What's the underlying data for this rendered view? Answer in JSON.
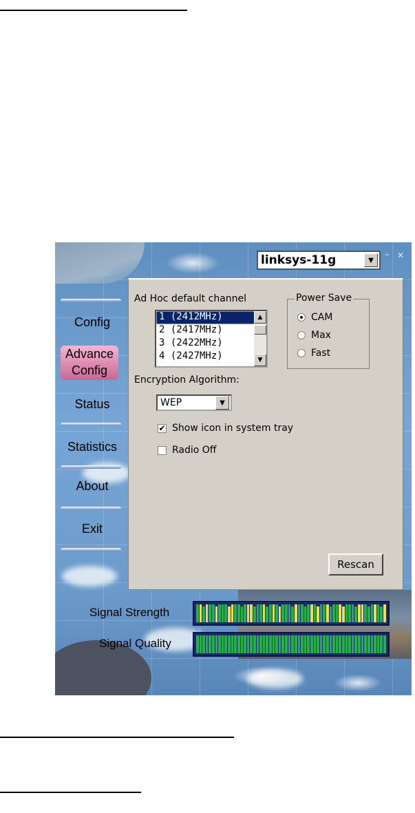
{
  "window": {
    "ssid": "linksys-11g",
    "minimize_glyph": "–",
    "close_glyph": "✕"
  },
  "nav": {
    "items": [
      {
        "id": "config",
        "label": "Config"
      },
      {
        "id": "advance-config",
        "label_line1": "Advance",
        "label_line2": "Config",
        "active": true
      },
      {
        "id": "status",
        "label": "Status"
      },
      {
        "id": "statistics",
        "label": "Statistics"
      },
      {
        "id": "about",
        "label": "About"
      },
      {
        "id": "exit",
        "label": "Exit"
      }
    ]
  },
  "adhoc": {
    "label": "Ad Hoc default channel",
    "channels": [
      "1  (2412MHz)",
      "2  (2417MHz)",
      "3  (2422MHz)",
      "4  (2427MHz)"
    ],
    "selected": "1  (2412MHz)"
  },
  "power_save": {
    "title": "Power Save",
    "options": [
      "CAM",
      "Max",
      "Fast"
    ],
    "selected": "CAM"
  },
  "encryption": {
    "label": "Encryption Algorithm:",
    "value": "WEP"
  },
  "options": {
    "show_icon_label": "Show icon in system tray",
    "show_icon_checked": true,
    "radio_off_label": "Radio Off",
    "radio_off_checked": false
  },
  "rescan_label": "Rescan",
  "meters": {
    "signal_strength_label": "Signal Strength",
    "signal_quality_label": "Signal Quality"
  },
  "colors": {
    "panel": "#d4d0c8",
    "selection": "#0a246a",
    "meter_bg": "#1a2a6a",
    "meter_green": "#22b14c",
    "meter_yellow": "#f0e040",
    "active_nav": "#d67aa4"
  }
}
